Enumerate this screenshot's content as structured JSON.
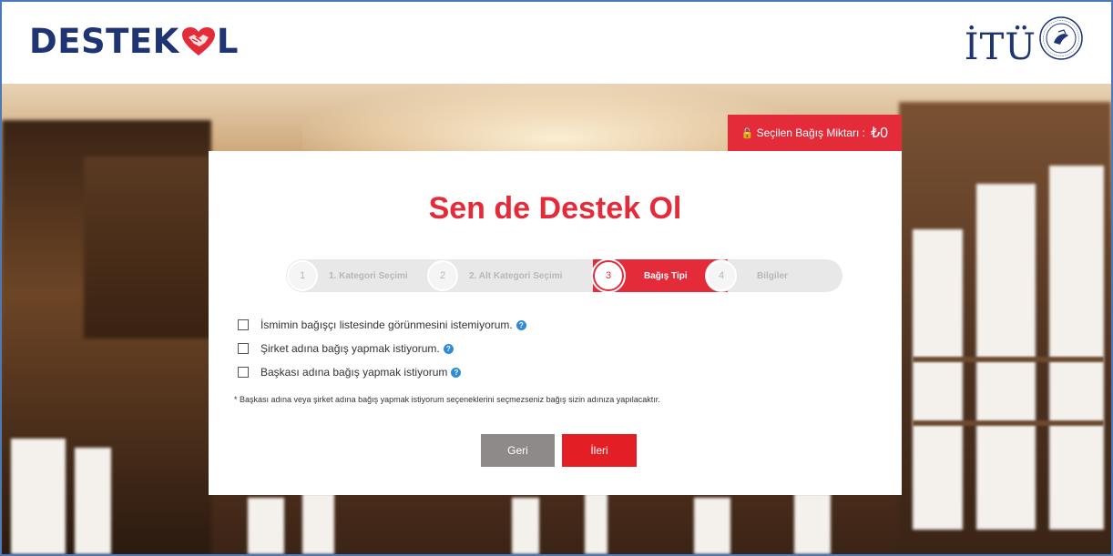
{
  "header": {
    "logo_left": "DESTEK",
    "logo_right": "L",
    "partner_logo": "İTÜ"
  },
  "badge": {
    "label": "Seçilen Bağış Miktarı :",
    "amount": "₺0"
  },
  "title": {
    "prefix": "Sen de ",
    "bold": "Destek Ol"
  },
  "steps": [
    {
      "num": "1",
      "label": "1. Kategori Seçimi",
      "state": "done"
    },
    {
      "num": "2",
      "label": "2. Alt Kategori Seçimi",
      "state": "done"
    },
    {
      "num": "3",
      "label": "Bağış Tipi",
      "state": "active"
    },
    {
      "num": "4",
      "label": "Bilgiler",
      "state": "pending"
    }
  ],
  "options": [
    {
      "label": "İsmimin bağışçı listesinde görünmesini istemiyorum.",
      "checked": false
    },
    {
      "label": "Şirket adına bağış yapmak istiyorum.",
      "checked": false
    },
    {
      "label": "Başkası adına bağış yapmak istiyorum",
      "checked": false
    }
  ],
  "note": "* Başkası adına veya şirket adına bağış yapmak istiyorum seçeneklerini seçmezseniz bağış sizin adınıza yapılacaktır.",
  "buttons": {
    "back": "Geri",
    "next": "İleri"
  },
  "colors": {
    "brand_red": "#e32b3a",
    "brand_navy": "#1f3473",
    "back_gray": "#8f8a8a",
    "help_blue": "#2f8bd8"
  }
}
